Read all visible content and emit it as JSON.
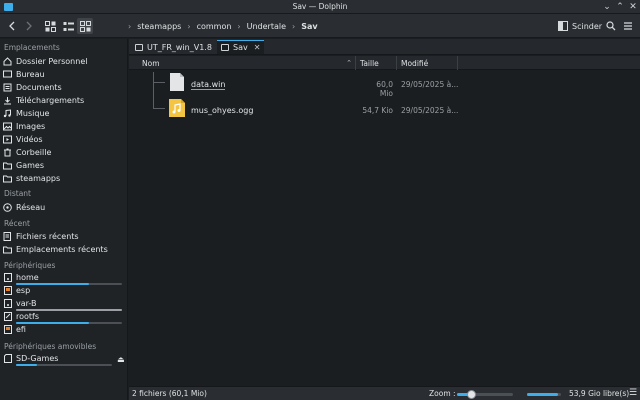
{
  "window": {
    "title": "Sav — Dolphin",
    "accent": "#3daee9"
  },
  "toolbar": {
    "breadcrumbs": [
      "steamapps",
      "common",
      "Undertale",
      "Sav"
    ],
    "split_label": "Scinder"
  },
  "sidebar": {
    "places_title": "Emplacements",
    "places": [
      {
        "label": "Dossier Personnel",
        "icon": "home-icon"
      },
      {
        "label": "Bureau",
        "icon": "desktop-icon"
      },
      {
        "label": "Documents",
        "icon": "document-icon"
      },
      {
        "label": "Téléchargements",
        "icon": "download-icon"
      },
      {
        "label": "Musique",
        "icon": "music-icon"
      },
      {
        "label": "Images",
        "icon": "image-icon"
      },
      {
        "label": "Vidéos",
        "icon": "video-icon"
      },
      {
        "label": "Corbeille",
        "icon": "trash-icon"
      },
      {
        "label": "Games",
        "icon": "folder-icon"
      },
      {
        "label": "steamapps",
        "icon": "folder-icon"
      }
    ],
    "remote_title": "Distant",
    "remote": [
      {
        "label": "Réseau",
        "icon": "network-icon"
      }
    ],
    "recent_title": "Récent",
    "recent": [
      {
        "label": "Fichiers récents",
        "icon": "recent-files-icon"
      },
      {
        "label": "Emplacements récents",
        "icon": "recent-places-icon"
      }
    ],
    "devices_title": "Périphériques",
    "devices": [
      {
        "label": "home",
        "icon": "drive-icon",
        "usage": 0.69
      },
      {
        "label": "esp",
        "icon": "drive-icon"
      },
      {
        "label": "var-B",
        "icon": "drive-icon",
        "usage": 1.0
      },
      {
        "label": "rootfs",
        "icon": "drive-icon",
        "usage": 0.69
      },
      {
        "label": "efi",
        "icon": "drive-icon"
      }
    ],
    "removable_title": "Périphériques amovibles",
    "removable": [
      {
        "label": "SD-Games",
        "icon": "sd-card-icon",
        "usage": 0.22
      }
    ]
  },
  "tabs": [
    {
      "label": "UT_FR_win_V1.8",
      "active": false
    },
    {
      "label": "Sav",
      "active": true
    }
  ],
  "columns": {
    "name": "Nom",
    "size": "Taille",
    "modified": "Modifié"
  },
  "files": [
    {
      "name": "data.win",
      "size": "60,0 Mio",
      "modified": "29/05/2025 à...",
      "icon": "file-icon"
    },
    {
      "name": "mus_ohyes.ogg",
      "size": "54,7 Kio",
      "modified": "29/05/2025 à...",
      "icon": "audio-file-icon"
    }
  ],
  "status": {
    "count": "2 fichiers (60,1 Mio)",
    "zoom_label": "Zoom :",
    "zoom_level": 0.25,
    "free_label": "53,9 Gio libre(s)",
    "free_usage": 0.9
  }
}
